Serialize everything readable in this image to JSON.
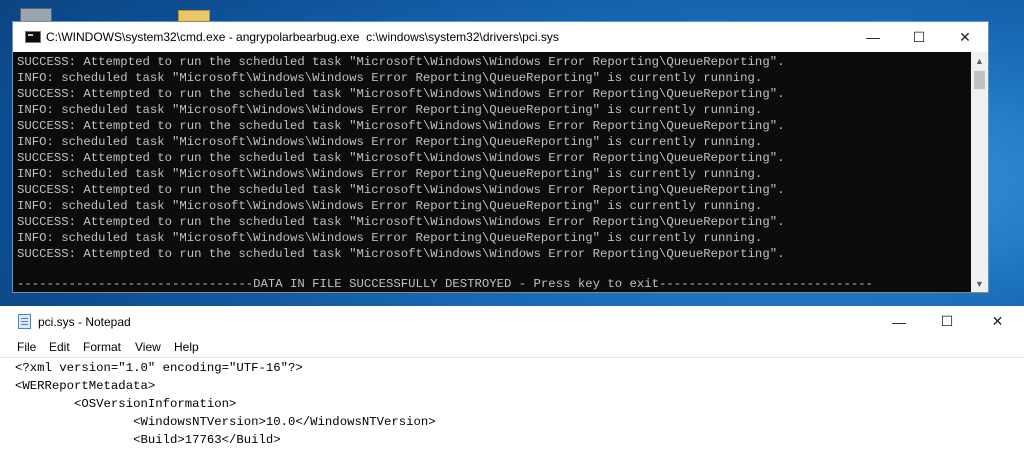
{
  "cmd": {
    "title": "C:\\WINDOWS\\system32\\cmd.exe - angrypolarbearbug.exe  c:\\windows\\system32\\drivers\\pci.sys",
    "lines": [
      "SUCCESS: Attempted to run the scheduled task \"Microsoft\\Windows\\Windows Error Reporting\\QueueReporting\".",
      "INFO: scheduled task \"Microsoft\\Windows\\Windows Error Reporting\\QueueReporting\" is currently running.",
      "SUCCESS: Attempted to run the scheduled task \"Microsoft\\Windows\\Windows Error Reporting\\QueueReporting\".",
      "INFO: scheduled task \"Microsoft\\Windows\\Windows Error Reporting\\QueueReporting\" is currently running.",
      "SUCCESS: Attempted to run the scheduled task \"Microsoft\\Windows\\Windows Error Reporting\\QueueReporting\".",
      "INFO: scheduled task \"Microsoft\\Windows\\Windows Error Reporting\\QueueReporting\" is currently running.",
      "SUCCESS: Attempted to run the scheduled task \"Microsoft\\Windows\\Windows Error Reporting\\QueueReporting\".",
      "INFO: scheduled task \"Microsoft\\Windows\\Windows Error Reporting\\QueueReporting\" is currently running.",
      "SUCCESS: Attempted to run the scheduled task \"Microsoft\\Windows\\Windows Error Reporting\\QueueReporting\".",
      "INFO: scheduled task \"Microsoft\\Windows\\Windows Error Reporting\\QueueReporting\" is currently running.",
      "SUCCESS: Attempted to run the scheduled task \"Microsoft\\Windows\\Windows Error Reporting\\QueueReporting\".",
      "INFO: scheduled task \"Microsoft\\Windows\\Windows Error Reporting\\QueueReporting\" is currently running.",
      "SUCCESS: Attempted to run the scheduled task \"Microsoft\\Windows\\Windows Error Reporting\\QueueReporting\"."
    ],
    "destroyed_line": "--------------------------------DATA IN FILE SUCCESSFULLY DESTROYED - Press key to exit-----------------------------",
    "controls": {
      "minimize": "—",
      "maximize": "☐",
      "close": "✕"
    }
  },
  "notepad": {
    "title": "pci.sys - Notepad",
    "menu": [
      "File",
      "Edit",
      "Format",
      "View",
      "Help"
    ],
    "lines": [
      "<?xml version=\"1.0\" encoding=\"UTF-16\"?>",
      "<WERReportMetadata>",
      "        <OSVersionInformation>",
      "                <WindowsNTVersion>10.0</WindowsNTVersion>",
      "                <Build>17763</Build>"
    ],
    "controls": {
      "minimize": "—",
      "maximize": "☐",
      "close": "✕"
    }
  },
  "icons": {
    "cmd_window_icon": "console-icon",
    "notepad_window_icon": "notepad-icon",
    "desktop_icons": [
      "this-pc-icon",
      "folder-icon"
    ]
  },
  "colors": {
    "console_bg": "#0c0c0c",
    "console_text": "#c0c0c0",
    "desktop_blue": "#1b6fbd"
  }
}
